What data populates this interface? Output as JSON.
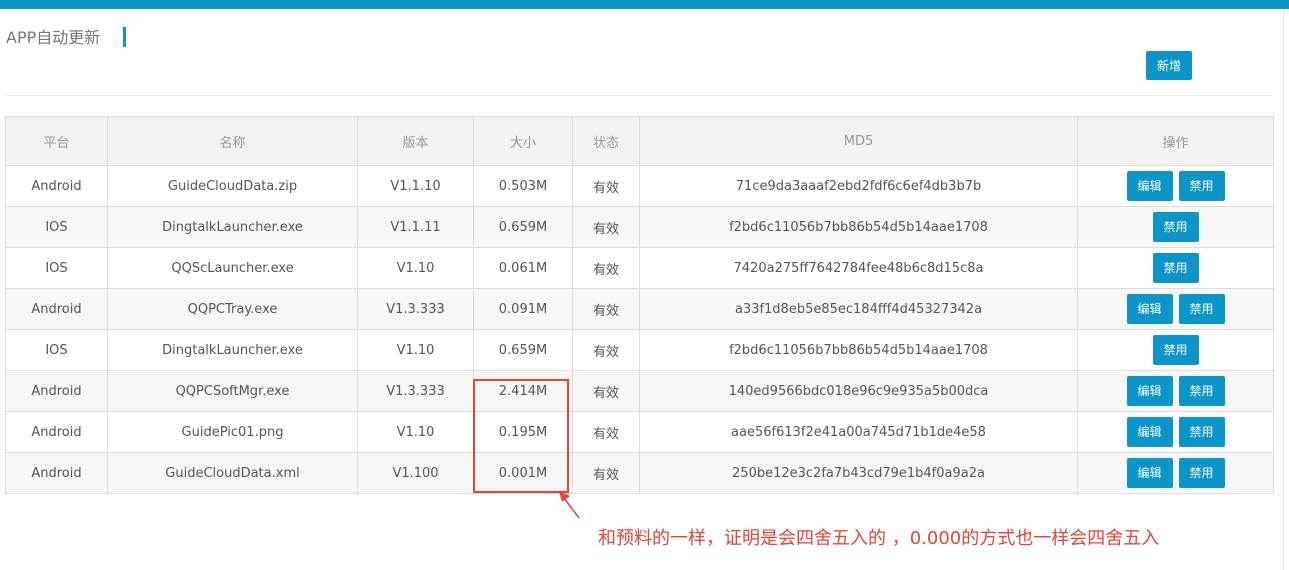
{
  "header": {
    "title": "APP自动更新",
    "add_label": "新增"
  },
  "table": {
    "columns": [
      "平台",
      "名称",
      "版本",
      "大小",
      "状态",
      "MD5",
      "操作"
    ],
    "rows": [
      {
        "platform": "Android",
        "name": "GuideCloudData.zip",
        "version": "V1.1.10",
        "size": "0.503M",
        "status": "有效",
        "md5": "71ce9da3aaaf2ebd2fdf6c6ef4db3b7b",
        "actions": [
          "编辑",
          "禁用"
        ]
      },
      {
        "platform": "IOS",
        "name": "DingtalkLauncher.exe",
        "version": "V1.1.11",
        "size": "0.659M",
        "status": "有效",
        "md5": "f2bd6c11056b7bb86b54d5b14aae1708",
        "actions": [
          "禁用"
        ]
      },
      {
        "platform": "IOS",
        "name": "QQScLauncher.exe",
        "version": "V1.10",
        "size": "0.061M",
        "status": "有效",
        "md5": "7420a275ff7642784fee48b6c8d15c8a",
        "actions": [
          "禁用"
        ]
      },
      {
        "platform": "Android",
        "name": "QQPCTray.exe",
        "version": "V1.3.333",
        "size": "0.091M",
        "status": "有效",
        "md5": "a33f1d8eb5e85ec184fff4d45327342a",
        "actions": [
          "编辑",
          "禁用"
        ]
      },
      {
        "platform": "IOS",
        "name": "DingtalkLauncher.exe",
        "version": "V1.10",
        "size": "0.659M",
        "status": "有效",
        "md5": "f2bd6c11056b7bb86b54d5b14aae1708",
        "actions": [
          "禁用"
        ]
      },
      {
        "platform": "Android",
        "name": "QQPCSoftMgr.exe",
        "version": "V1.3.333",
        "size": "2.414M",
        "status": "有效",
        "md5": "140ed9566bdc018e96c9e935a5b00dca",
        "actions": [
          "编辑",
          "禁用"
        ]
      },
      {
        "platform": "Android",
        "name": "GuidePic01.png",
        "version": "V1.10",
        "size": "0.195M",
        "status": "有效",
        "md5": "aae56f613f2e41a00a745d71b1de4e58",
        "actions": [
          "编辑",
          "禁用"
        ]
      },
      {
        "platform": "Android",
        "name": "GuideCloudData.xml",
        "version": "V1.100",
        "size": "0.001M",
        "status": "有效",
        "md5": "250be12e3c2fa7b43cd79e1b4f0a9a2a",
        "actions": [
          "编辑",
          "禁用"
        ]
      }
    ]
  },
  "annotation": {
    "note": "和预料的一样，证明是会四舍五入的 ，0.000的方式也一样会四舍五入"
  },
  "colors": {
    "accent": "#0b95c8",
    "annotation": "#e8443a"
  }
}
